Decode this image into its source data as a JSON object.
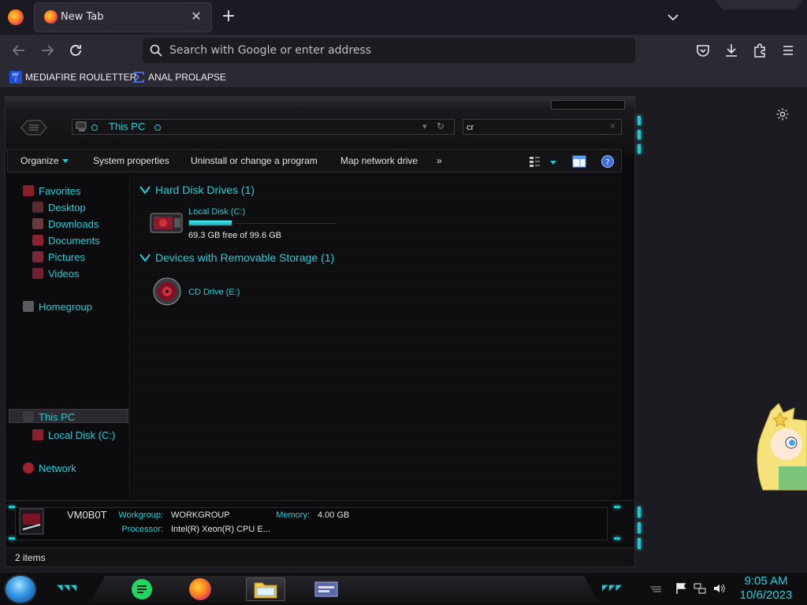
{
  "browser": {
    "tab": {
      "title": "New Tab"
    },
    "urlbar": {
      "placeholder": "Search with Google or enter address"
    },
    "bookmarks": [
      {
        "label": "MEDIAFIRE ROULETTER"
      },
      {
        "label": "ANAL PROLAPSE"
      }
    ]
  },
  "explorer": {
    "address": "This PC",
    "search_value": "cr",
    "commands": {
      "organize": "Organize",
      "system_properties": "System properties",
      "uninstall": "Uninstall or change a program",
      "map_drive": "Map network drive",
      "more": "»"
    },
    "sidebar": {
      "favorites": "Favorites",
      "desktop": "Desktop",
      "downloads": "Downloads",
      "documents": "Documents",
      "pictures": "Pictures",
      "videos": "Videos",
      "homegroup": "Homegroup",
      "this_pc": "This PC",
      "local_disk": "Local Disk (C:)",
      "network": "Network"
    },
    "groups": {
      "hdd_title": "Hard Disk Drives (1)",
      "removable_title": "Devices with Removable Storage (1)"
    },
    "drives": {
      "c_name": "Local Disk (C:)",
      "c_free": "69.3 GB free of 99.6 GB",
      "c_used_fraction": 0.304,
      "cd_name": "CD Drive (E:)"
    },
    "details": {
      "computer_name": "VM0B0T",
      "workgroup_label": "Workgroup:",
      "workgroup_value": "WORKGROUP",
      "memory_label": "Memory:",
      "memory_value": "4.00 GB",
      "processor_label": "Processor:",
      "processor_value": "Intel(R) Xeon(R) CPU E..."
    },
    "status": "2 items"
  },
  "taskbar": {
    "time": "9:05 AM",
    "date": "10/6/2023"
  },
  "colors": {
    "accent": "#1fd1db",
    "browser_bg": "#2b2a33"
  }
}
